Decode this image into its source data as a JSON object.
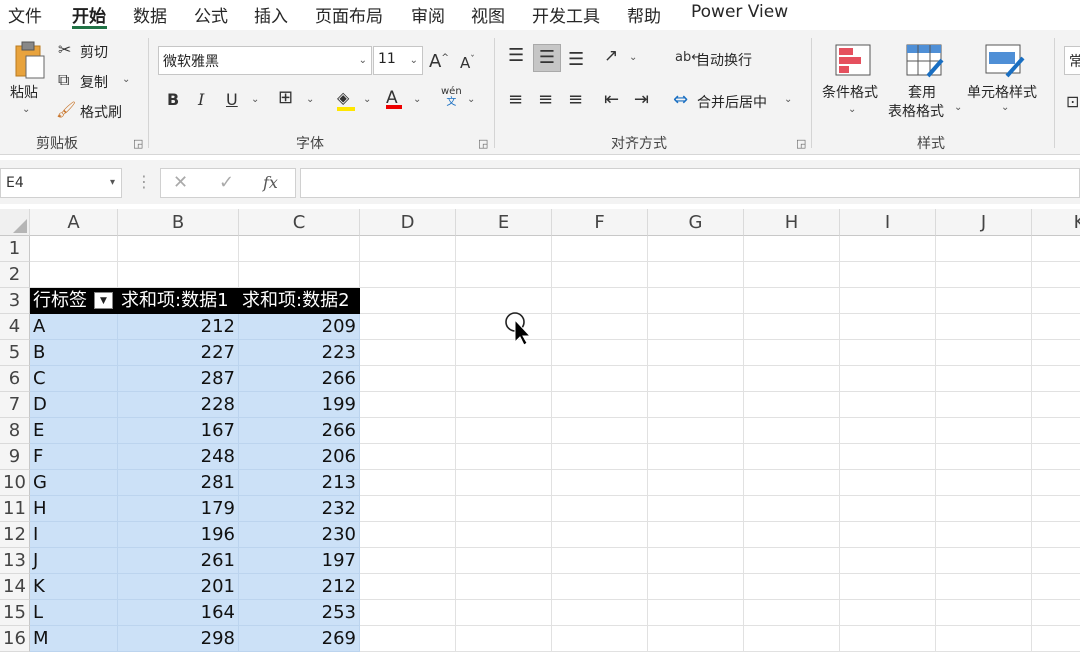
{
  "menu": {
    "tabs": [
      "文件",
      "开始",
      "数据",
      "公式",
      "插入",
      "页面布局",
      "审阅",
      "视图",
      "开发工具",
      "帮助",
      "Power View"
    ]
  },
  "ribbon": {
    "clipboard": {
      "paste": "粘贴",
      "cut": "剪切",
      "copy": "复制",
      "format_painter": "格式刷",
      "group": "剪贴板"
    },
    "font": {
      "name": "微软雅黑",
      "size": "11",
      "group": "字体",
      "bold": "B",
      "italic": "I",
      "underline": "U",
      "phonetic_top": "wén",
      "phonetic_bottom": "文"
    },
    "align": {
      "wrap": "自动换行",
      "merge": "合并后居中",
      "group": "对齐方式"
    },
    "styles": {
      "conditional": "条件格式",
      "table_line1": "套用",
      "table_line2": "表格格式",
      "cell": "单元格样式",
      "group": "样式"
    },
    "number": {
      "partial": "常"
    }
  },
  "formula_bar": {
    "name_box": "E4",
    "fx": "fx",
    "formula": ""
  },
  "sheet": {
    "columns": [
      "A",
      "B",
      "C",
      "D",
      "E",
      "F",
      "G",
      "H",
      "I",
      "J",
      "K"
    ],
    "rows": [
      "1",
      "2",
      "3",
      "4",
      "5",
      "6",
      "7",
      "8",
      "9",
      "10",
      "11",
      "12",
      "13",
      "14",
      "15",
      "16"
    ],
    "pivot_headers": [
      "行标签",
      "求和项:数据1",
      "求和项:数据2"
    ],
    "pivot_rows": [
      [
        "A",
        "212",
        "209"
      ],
      [
        "B",
        "227",
        "223"
      ],
      [
        "C",
        "287",
        "266"
      ],
      [
        "D",
        "228",
        "199"
      ],
      [
        "E",
        "167",
        "266"
      ],
      [
        "F",
        "248",
        "206"
      ],
      [
        "G",
        "281",
        "213"
      ],
      [
        "H",
        "179",
        "232"
      ],
      [
        "I",
        "196",
        "230"
      ],
      [
        "J",
        "261",
        "197"
      ],
      [
        "K",
        "201",
        "212"
      ],
      [
        "L",
        "164",
        "253"
      ],
      [
        "M",
        "298",
        "269"
      ]
    ],
    "selection_color": "#cce1f7",
    "header_color": "#000000"
  }
}
